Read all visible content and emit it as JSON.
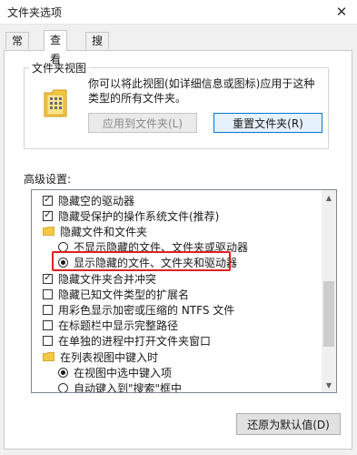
{
  "window": {
    "title": "文件夹选项",
    "close_glyph": "✕"
  },
  "tabs": [
    {
      "label": "常规",
      "active": false
    },
    {
      "label": "查看",
      "active": true
    },
    {
      "label": "搜索",
      "active": false
    }
  ],
  "folder_views": {
    "title": "文件夹视图",
    "description": "你可以将此视图(如详细信息或图标)应用于这种类型的所有文件夹。",
    "apply_button": "应用到文件夹(L)",
    "reset_button": "重置文件夹(R)",
    "icon": "folder-grid-icon"
  },
  "advanced": {
    "label": "高级设置:",
    "items": [
      {
        "type": "checkbox",
        "checked": true,
        "label": "隐藏空的驱动器",
        "indent": 0
      },
      {
        "type": "checkbox",
        "checked": true,
        "label": "隐藏受保护的操作系统文件(推荐)",
        "indent": 0
      },
      {
        "type": "folder",
        "label": "隐藏文件和文件夹",
        "indent": 0
      },
      {
        "type": "radio",
        "checked": false,
        "label": "不显示隐藏的文件、文件夹或驱动器",
        "indent": 1
      },
      {
        "type": "radio",
        "checked": true,
        "label": "显示隐藏的文件、文件夹和驱动器",
        "indent": 1
      },
      {
        "type": "checkbox",
        "checked": true,
        "label": "隐藏文件夹合并冲突",
        "indent": 0
      },
      {
        "type": "checkbox",
        "checked": false,
        "label": "隐藏已知文件类型的扩展名",
        "indent": 0
      },
      {
        "type": "checkbox",
        "checked": false,
        "label": "用彩色显示加密或压缩的 NTFS 文件",
        "indent": 0
      },
      {
        "type": "checkbox",
        "checked": false,
        "label": "在标题栏中显示完整路径",
        "indent": 0
      },
      {
        "type": "checkbox",
        "checked": false,
        "label": "在单独的进程中打开文件夹窗口",
        "indent": 0
      },
      {
        "type": "folder",
        "label": "在列表视图中键入时",
        "indent": 0
      },
      {
        "type": "radio",
        "checked": true,
        "label": "在视图中选中键入项",
        "indent": 1
      },
      {
        "type": "radio",
        "checked": false,
        "label": "自动键入到\"搜索\"框中",
        "indent": 1
      }
    ]
  },
  "restore_button": "还原为默认值(D)",
  "colors": {
    "accent": "#0078d7",
    "highlight_border": "#e02020",
    "folder": "#f5c842"
  }
}
